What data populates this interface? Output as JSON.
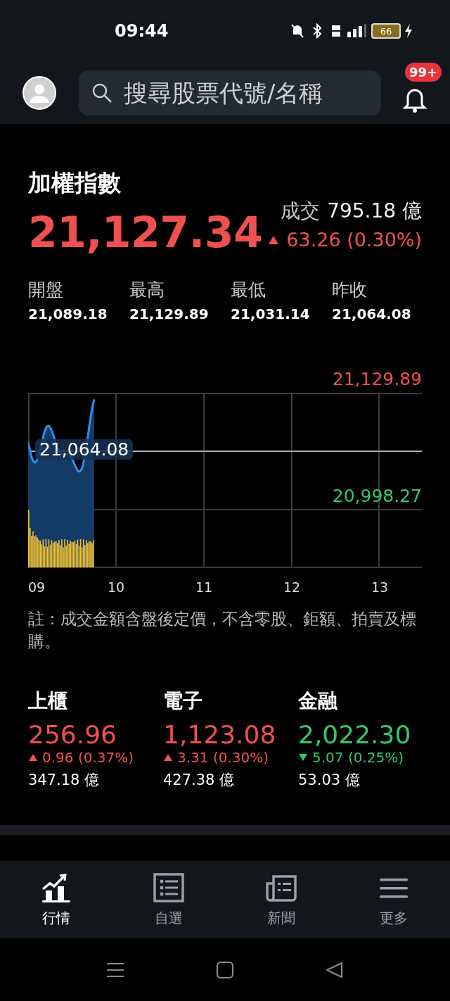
{
  "status_bar": {
    "time": "09:44",
    "battery": "66"
  },
  "header": {
    "search": {
      "placeholder": "搜尋股票代號/名稱"
    },
    "notification_badge": "99+"
  },
  "index": {
    "name": "加權指數",
    "price": "21,127.34",
    "volume_label": "成交",
    "volume": "795.18 億",
    "change": "63.26 (0.30%)",
    "kind": "up",
    "stats": [
      {
        "label": "開盤",
        "value": "21,089.18"
      },
      {
        "label": "最高",
        "value": "21,129.89"
      },
      {
        "label": "最低",
        "value": "21,031.14"
      },
      {
        "label": "昨收",
        "value": "21,064.08"
      }
    ]
  },
  "chart": {
    "high": "21,129.89",
    "reference": "21,064.08",
    "low": "20,998.27",
    "hours": [
      "09",
      "10",
      "11",
      "12",
      "13"
    ]
  },
  "note": "註：成交金額含盤後定價，不含零股、鉅額、拍賣及標購。",
  "sub_indices": [
    {
      "name": "上櫃",
      "price": "256.96",
      "change": "0.96 (0.37%)",
      "kind": "up",
      "volume": "347.18 億"
    },
    {
      "name": "電子",
      "price": "1,123.08",
      "change": "3.31 (0.30%)",
      "kind": "up",
      "volume": "427.38 億"
    },
    {
      "name": "金融",
      "price": "2,022.30",
      "change": "5.07 (0.25%)",
      "kind": "down",
      "volume": "53.03 億"
    }
  ],
  "tabs": [
    {
      "label": "行情",
      "selected": true
    },
    {
      "label": "自選",
      "selected": false
    },
    {
      "label": "新聞",
      "selected": false
    },
    {
      "label": "更多",
      "selected": false
    }
  ]
}
